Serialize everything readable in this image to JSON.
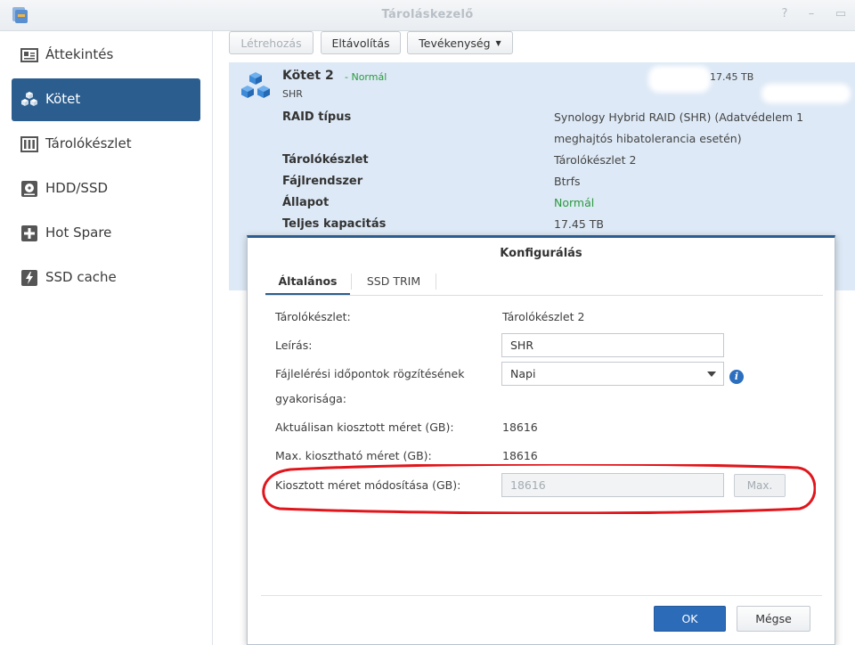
{
  "window": {
    "title": "Tároláskezelő"
  },
  "sidebar": {
    "items": [
      {
        "label": "Áttekintés",
        "icon": "overview-icon"
      },
      {
        "label": "Kötet",
        "icon": "volume-cubes-icon",
        "active": true
      },
      {
        "label": "Tárolókészlet",
        "icon": "storage-pool-icon"
      },
      {
        "label": "HDD/SSD",
        "icon": "hdd-icon"
      },
      {
        "label": "Hot Spare",
        "icon": "hot-spare-icon"
      },
      {
        "label": "SSD cache",
        "icon": "ssd-cache-icon"
      }
    ]
  },
  "toolbar": {
    "create_label": "Létrehozás",
    "remove_label": "Eltávolítás",
    "action_label": "Tevékenység"
  },
  "volume": {
    "title": "Kötet 2",
    "status": "- Normál",
    "subtitle": "SHR",
    "size": "17.45 TB",
    "props": [
      {
        "label": "RAID típus",
        "value": "Synology Hybrid RAID (SHR) (Adatvédelem 1 meghajtós hibatolerancia esetén)"
      },
      {
        "label": "Tárolókészlet",
        "value": "Tárolókészlet 2"
      },
      {
        "label": "Fájlrendszer",
        "value": "Btrfs"
      },
      {
        "label": "Állapot",
        "value": "Normál"
      },
      {
        "label": "Teljes kapacitás",
        "value": "17.45 TB"
      }
    ]
  },
  "dialog": {
    "title": "Konfigurálás",
    "tabs": [
      "Általános",
      "SSD TRIM"
    ],
    "fields": {
      "pool_label": "Tárolókészlet:",
      "pool_value": "Tárolókészlet 2",
      "desc_label": "Leírás:",
      "desc_value": "SHR",
      "atime_label": "Fájlelérési időpontok rögzítésének gyakorisága:",
      "atime_value": "Napi",
      "current_label": "Aktuálisan kiosztott méret (GB):",
      "current_value": "18616",
      "max_label": "Max. kiosztható méret (GB):",
      "max_value": "18616",
      "modify_label": "Kiosztott méret módosítása (GB):",
      "modify_value": "18616",
      "max_button": "Max."
    },
    "ok_label": "OK",
    "cancel_label": "Mégse"
  },
  "colors": {
    "accent": "#2b5e8f",
    "ok": "#2c6bb8",
    "status_green": "#2b9a3f",
    "annotation": "#e0161c"
  }
}
